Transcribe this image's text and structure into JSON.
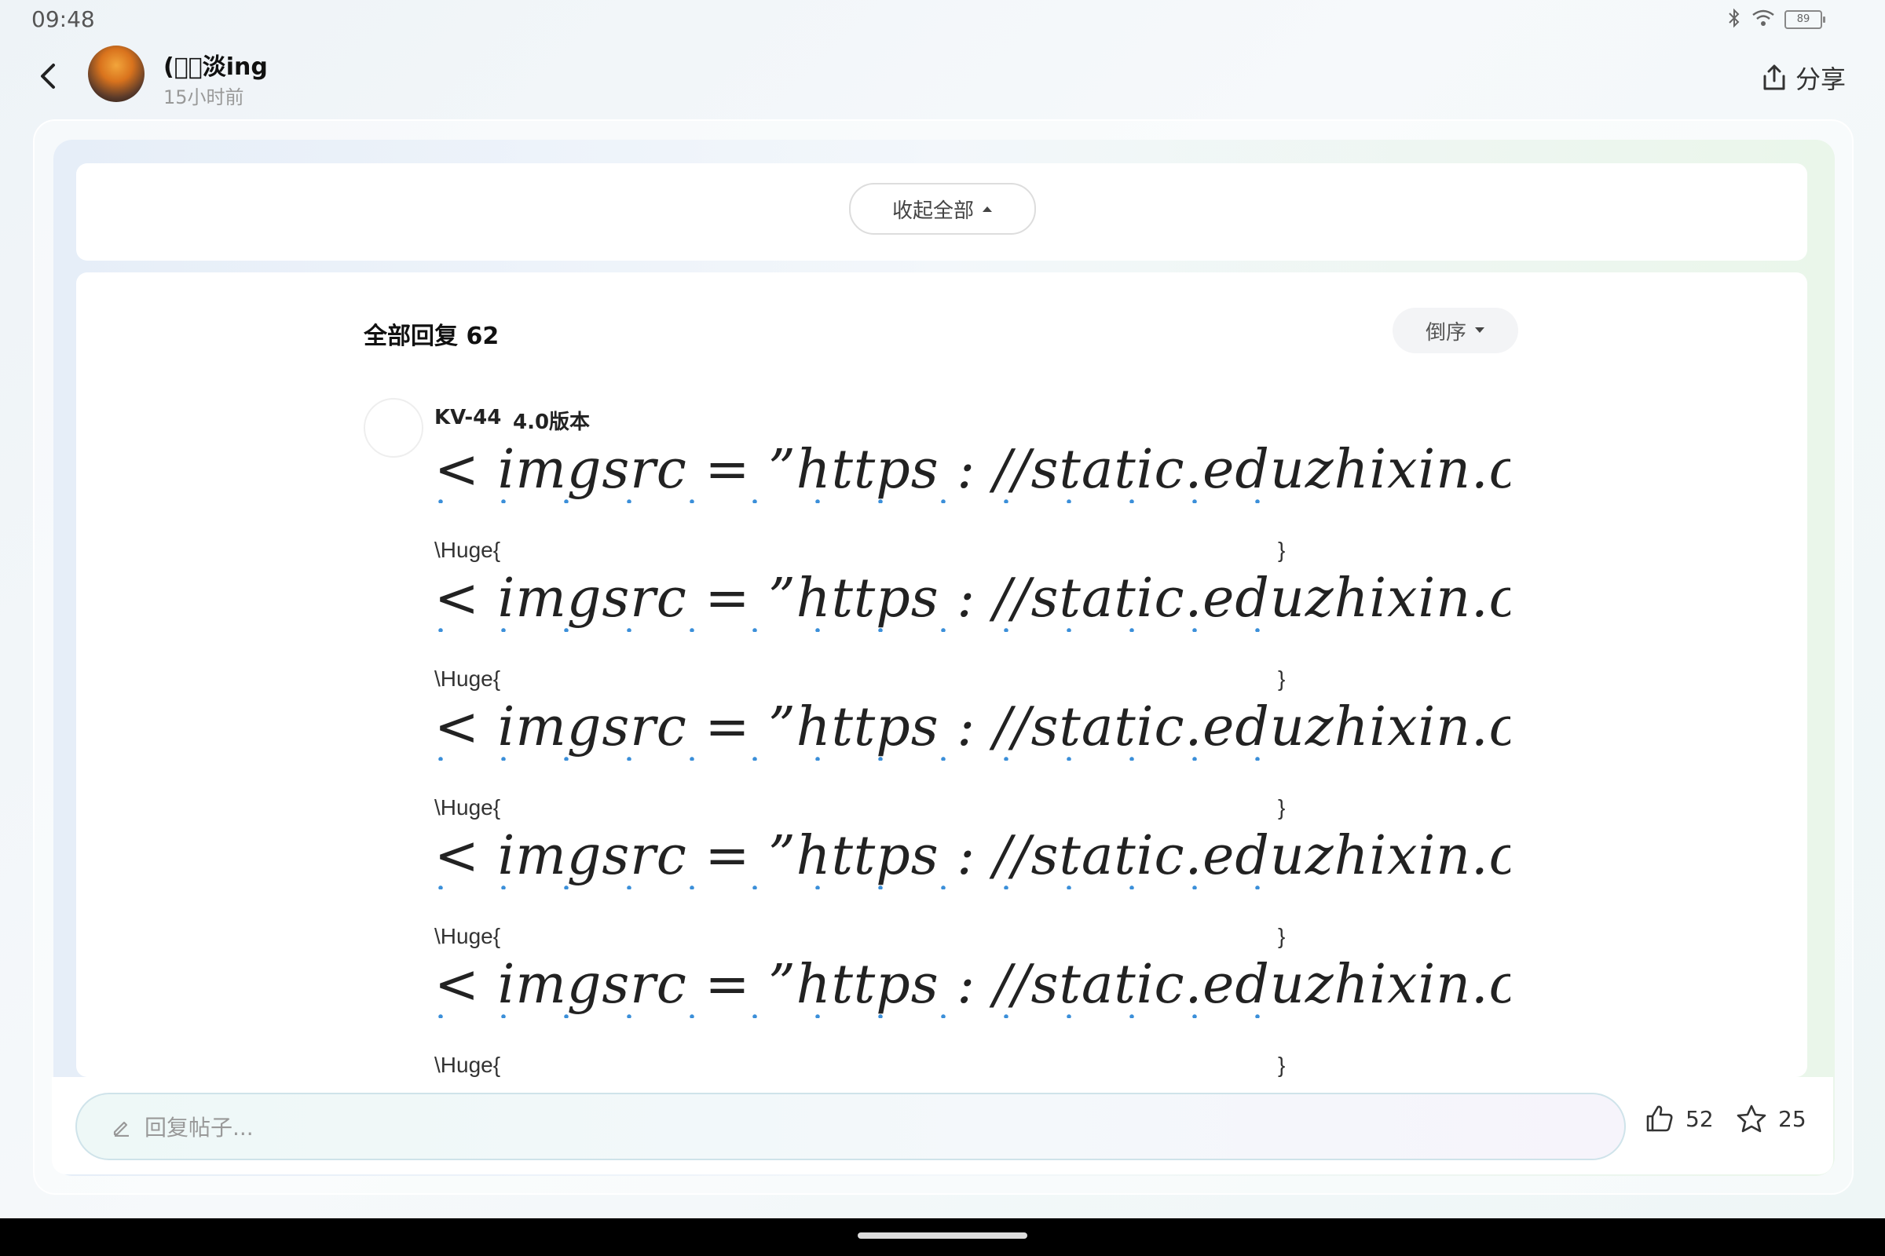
{
  "status": {
    "time": "09:48",
    "battery": "89",
    "icons": [
      "bluetooth-icon",
      "wifi-icon",
      "battery-icon"
    ]
  },
  "header": {
    "username": "(ﾟﾟ淡ing",
    "post_time": "15小时前",
    "share_label": "分享"
  },
  "collapse": {
    "label": "收起全部"
  },
  "replies": {
    "header": "全部回复 62",
    "sort_label": "倒序"
  },
  "reply": {
    "name": "KV-44",
    "version": "4.0版本",
    "lines": [
      {
        "text": "< imgsrc = ”https : //static.eduzhixin.co",
        "cmd": "\\Huge{",
        "close": "}"
      },
      {
        "text": "< imgsrc = ”https : //static.eduzhixin.co",
        "cmd": "\\Huge{",
        "close": "}"
      },
      {
        "text": "< imgsrc = ”https : //static.eduzhixin.co",
        "cmd": "\\Huge{",
        "close": "}"
      },
      {
        "text": "< imgsrc = ”https : //static.eduzhixin.co",
        "cmd": "\\Huge{",
        "close": "}"
      },
      {
        "text": "< imgsrc = ”https : //static.eduzhixin.co",
        "cmd": "\\Huge{",
        "close": "}"
      }
    ]
  },
  "bottom": {
    "reply_placeholder": "回复帖子...",
    "like_count": "52",
    "fav_count": "25"
  }
}
